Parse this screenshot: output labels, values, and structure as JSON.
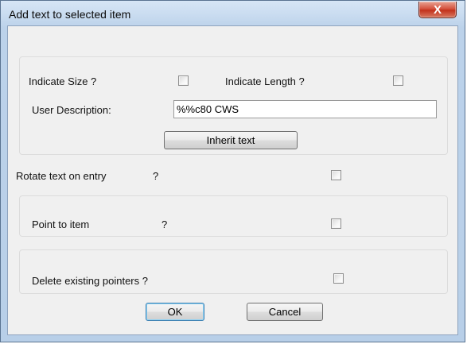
{
  "window": {
    "title": "Add text to selected item",
    "close_glyph": "X"
  },
  "size_length_group": {
    "indicate_size_label": "Indicate Size ?",
    "indicate_size_checked": false,
    "indicate_length_label": "Indicate Length ?",
    "indicate_length_checked": false,
    "user_description_label": "User Description:",
    "user_description_value": "%%c80 CWS",
    "inherit_button_label": "Inherit text"
  },
  "rotate": {
    "label": "Rotate text on entry",
    "question": "?",
    "checked": false
  },
  "point_group": {
    "label": "Point to item",
    "question": "?",
    "checked": false
  },
  "delete_group": {
    "label": "Delete existing pointers ?",
    "checked": false
  },
  "buttons": {
    "ok_label": "OK",
    "cancel_label": "Cancel"
  },
  "colors": {
    "window_frame": "#b8cfe8",
    "close_button": "#c2321c",
    "default_button_border": "#3c7fb1"
  }
}
